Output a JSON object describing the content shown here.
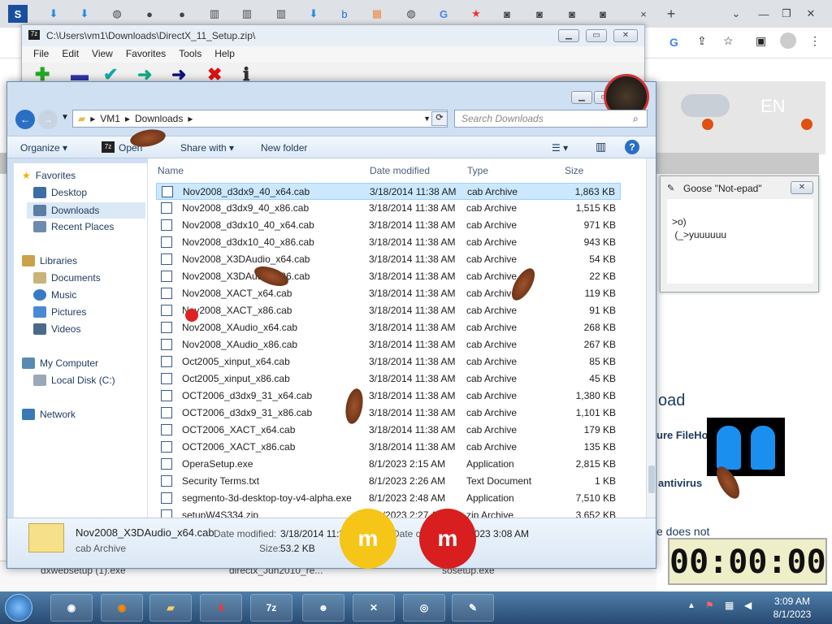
{
  "chrome": {
    "new_tab": "+",
    "close_tab": "×",
    "page_lang": "EN",
    "page_heading": "oad",
    "page_text1": "ure FileHo",
    "page_text2": "antivirus",
    "page_text3": "e does not",
    "downloads": [
      "dxwebsetup (1).exe",
      "directx_Jun2010_re...",
      "sosetup.exe"
    ]
  },
  "zip_window": {
    "title": "C:\\Users\\vm1\\Downloads\\DirectX_11_Setup.zip\\",
    "menu": [
      "File",
      "Edit",
      "View",
      "Favorites",
      "Tools",
      "Help"
    ]
  },
  "explorer": {
    "breadcrumb": [
      "VM1",
      "Downloads"
    ],
    "search_placeholder": "Search Downloads",
    "commands": {
      "organize": "Organize",
      "open": "Open",
      "share": "Share with",
      "new_folder": "New folder"
    },
    "nav": {
      "favorites": "Favorites",
      "desktop": "Desktop",
      "downloads": "Downloads",
      "recent": "Recent Places",
      "libraries": "Libraries",
      "documents": "Documents",
      "music": "Music",
      "pictures": "Pictures",
      "videos": "Videos",
      "computer": "My Computer",
      "local_disk": "Local Disk (C:)",
      "network": "Network"
    },
    "columns": {
      "name": "Name",
      "date": "Date modified",
      "type": "Type",
      "size": "Size"
    },
    "files": [
      {
        "name": "Nov2008_d3dx9_40_x64.cab",
        "date": "3/18/2014 11:38 AM",
        "type": "cab Archive",
        "size": "1,863 KB"
      },
      {
        "name": "Nov2008_d3dx9_40_x86.cab",
        "date": "3/18/2014 11:38 AM",
        "type": "cab Archive",
        "size": "1,515 KB"
      },
      {
        "name": "Nov2008_d3dx10_40_x64.cab",
        "date": "3/18/2014 11:38 AM",
        "type": "cab Archive",
        "size": "971 KB"
      },
      {
        "name": "Nov2008_d3dx10_40_x86.cab",
        "date": "3/18/2014 11:38 AM",
        "type": "cab Archive",
        "size": "943 KB"
      },
      {
        "name": "Nov2008_X3DAudio_x64.cab",
        "date": "3/18/2014 11:38 AM",
        "type": "cab Archive",
        "size": "54 KB"
      },
      {
        "name": "Nov2008_X3DAudio_x86.cab",
        "date": "3/18/2014 11:38 AM",
        "type": "cab Archive",
        "size": "22 KB"
      },
      {
        "name": "Nov2008_XACT_x64.cab",
        "date": "3/18/2014 11:38 AM",
        "type": "cab Archive",
        "size": "119 KB"
      },
      {
        "name": "Nov2008_XACT_x86.cab",
        "date": "3/18/2014 11:38 AM",
        "type": "cab Archive",
        "size": "91 KB"
      },
      {
        "name": "Nov2008_XAudio_x64.cab",
        "date": "3/18/2014 11:38 AM",
        "type": "cab Archive",
        "size": "268 KB"
      },
      {
        "name": "Nov2008_XAudio_x86.cab",
        "date": "3/18/2014 11:38 AM",
        "type": "cab Archive",
        "size": "267 KB"
      },
      {
        "name": "Oct2005_xinput_x64.cab",
        "date": "3/18/2014 11:38 AM",
        "type": "cab Archive",
        "size": "85 KB"
      },
      {
        "name": "Oct2005_xinput_x86.cab",
        "date": "3/18/2014 11:38 AM",
        "type": "cab Archive",
        "size": "45 KB"
      },
      {
        "name": "OCT2006_d3dx9_31_x64.cab",
        "date": "3/18/2014 11:38 AM",
        "type": "cab Archive",
        "size": "1,380 KB"
      },
      {
        "name": "OCT2006_d3dx9_31_x86.cab",
        "date": "3/18/2014 11:38 AM",
        "type": "cab Archive",
        "size": "1,101 KB"
      },
      {
        "name": "OCT2006_XACT_x64.cab",
        "date": "3/18/2014 11:38 AM",
        "type": "cab Archive",
        "size": "179 KB"
      },
      {
        "name": "OCT2006_XACT_x86.cab",
        "date": "3/18/2014 11:38 AM",
        "type": "cab Archive",
        "size": "135 KB"
      },
      {
        "name": "OperaSetup.exe",
        "date": "8/1/2023 2:15 AM",
        "type": "Application",
        "size": "2,815 KB"
      },
      {
        "name": "Security Terms.txt",
        "date": "8/1/2023 2:26 AM",
        "type": "Text Document",
        "size": "1 KB"
      },
      {
        "name": "segmento-3d-desktop-toy-v4-alpha.exe",
        "date": "8/1/2023 2:48 AM",
        "type": "Application",
        "size": "7,510 KB"
      },
      {
        "name": "setupW4S334.zip",
        "date": "8/1/2023 2:27 AM",
        "type": "zip Archive",
        "size": "3,652 KB"
      }
    ],
    "details": {
      "name": "Nov2008_X3DAudio_x64.cab",
      "type": "cab Archive",
      "modified_label": "Date modified:",
      "modified": "3/18/2014 11:38",
      "created_label": "Date cre",
      "created": "2023 3:08 AM",
      "size_label": "Size:",
      "size": "53.2 KB"
    }
  },
  "goose": {
    "title": "Goose \"Not-epad\"",
    "text": ">o)\n (_>yuuuuuu"
  },
  "taskbar": {
    "time": "3:09 AM",
    "date": "8/1/2023"
  },
  "timer": "00:00:00",
  "mm_label": "m"
}
